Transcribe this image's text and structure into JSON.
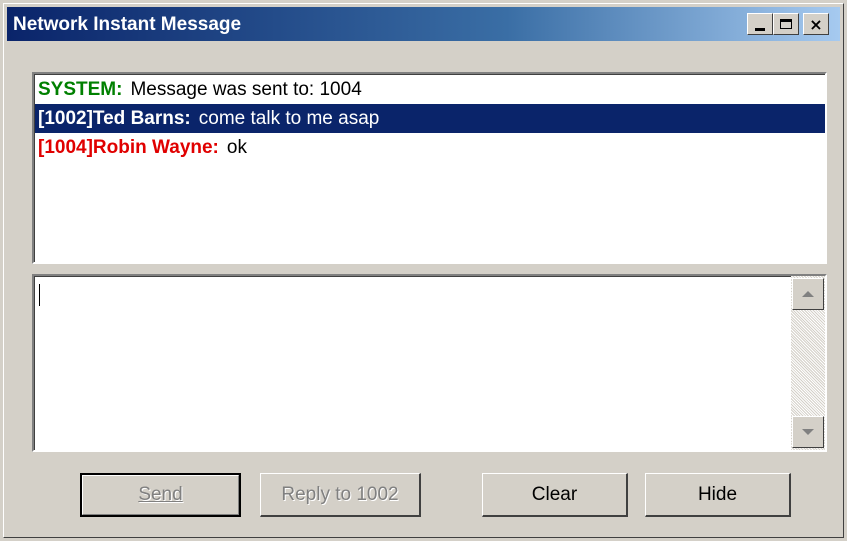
{
  "window": {
    "title": "Network Instant Message",
    "controls": {
      "minimize": "minimize-icon",
      "maximize": "maximize-icon",
      "close": "×"
    }
  },
  "history": {
    "messages": [
      {
        "sender": "SYSTEM:",
        "text": "Message was sent to: 1004",
        "color": "#008000",
        "selected": false
      },
      {
        "sender": "[1002]Ted Barns:",
        "text": "come talk to me asap",
        "color": "#000000",
        "selected": true
      },
      {
        "sender": "[1004]Robin Wayne:",
        "text": "ok",
        "color": "#e00000",
        "selected": false
      }
    ]
  },
  "compose": {
    "value": ""
  },
  "buttons": {
    "send": "Send",
    "reply": "Reply to 1002",
    "clear": "Clear",
    "hide": "Hide"
  },
  "colors": {
    "selection": "#0a246a",
    "title_bar": "#0a246a"
  }
}
